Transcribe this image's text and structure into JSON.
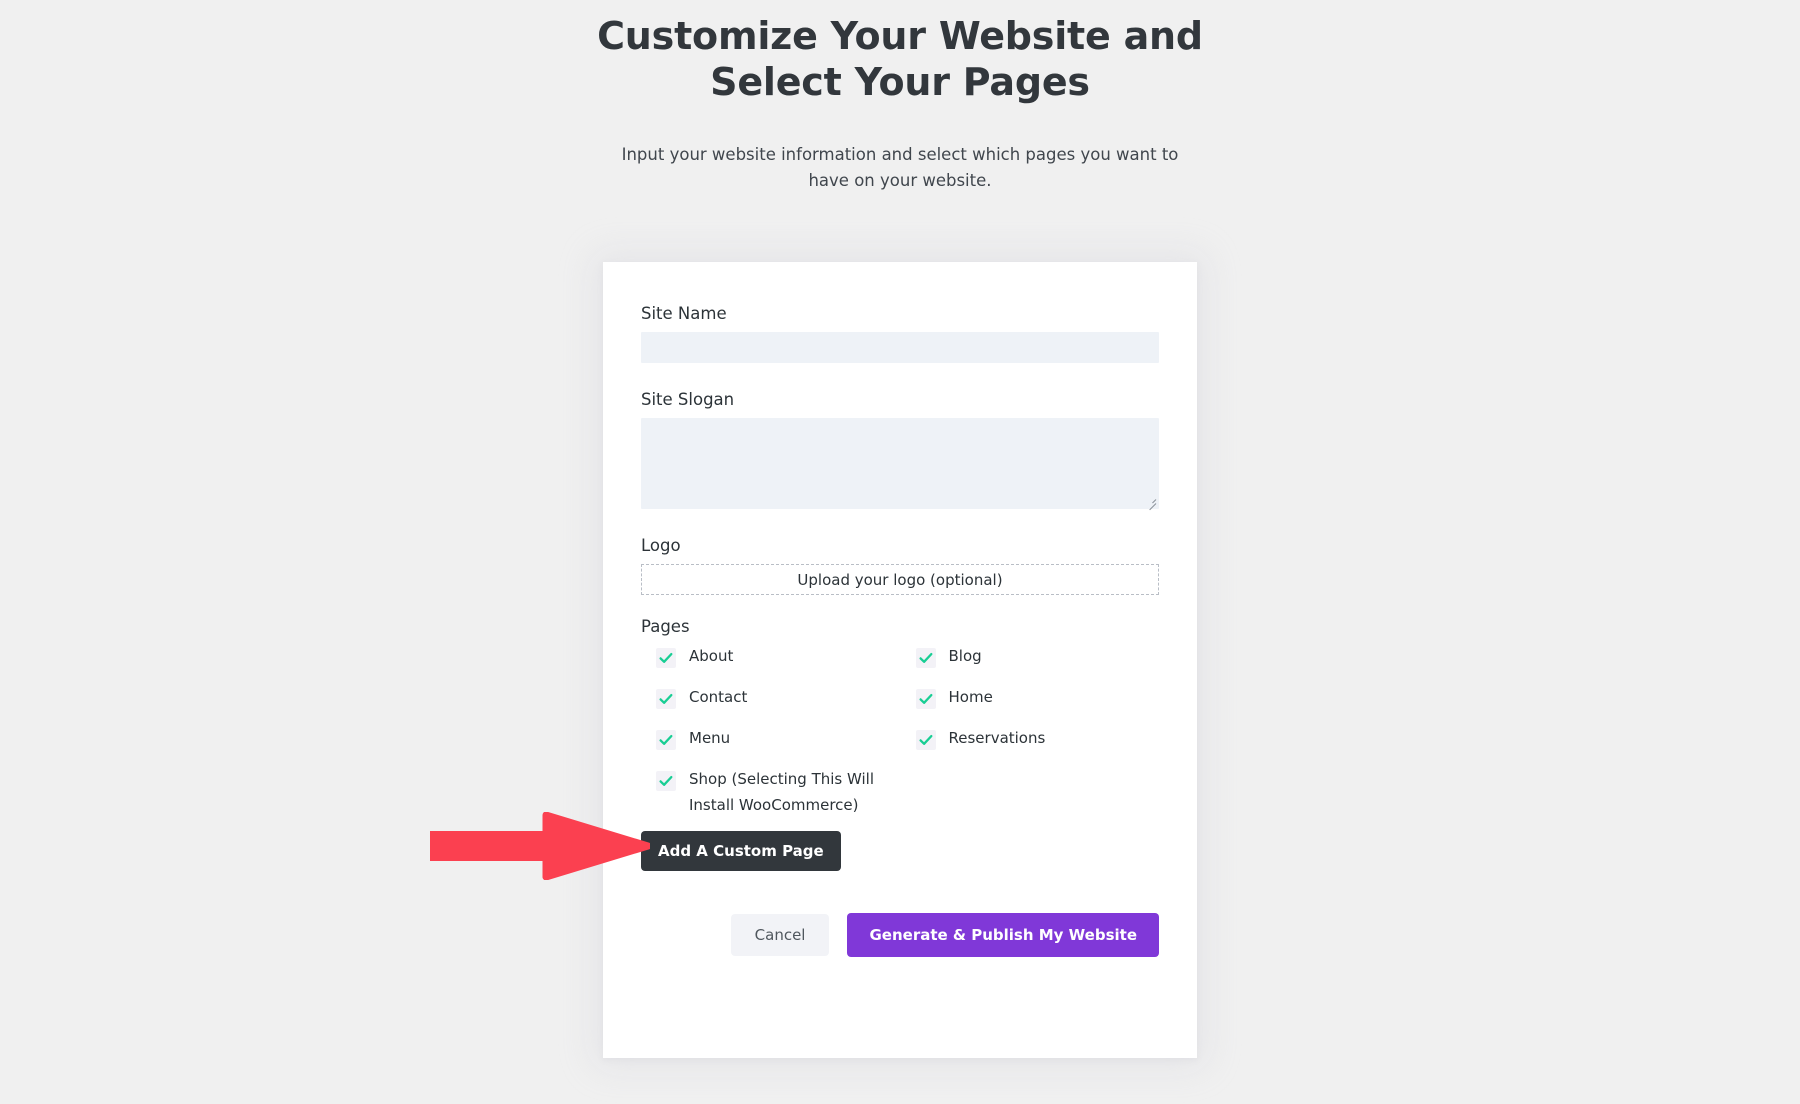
{
  "header": {
    "title": "Customize Your Website and Select Your Pages",
    "subtitle": "Input your website information and select which pages you want to have on your website."
  },
  "form": {
    "site_name": {
      "label": "Site Name",
      "value": "",
      "placeholder": ""
    },
    "site_slogan": {
      "label": "Site Slogan",
      "value": "",
      "placeholder": ""
    },
    "logo": {
      "label": "Logo",
      "upload_text": "Upload your logo (optional)"
    },
    "pages": {
      "label": "Pages",
      "options": [
        {
          "label": "About",
          "checked": true
        },
        {
          "label": "Blog",
          "checked": true
        },
        {
          "label": "Contact",
          "checked": true
        },
        {
          "label": "Home",
          "checked": true
        },
        {
          "label": "Menu",
          "checked": true
        },
        {
          "label": "Reservations",
          "checked": true
        },
        {
          "label": "Shop (Selecting This Will Install WooCommerce)",
          "checked": true
        }
      ]
    },
    "add_custom_page_label": "Add A Custom Page"
  },
  "actions": {
    "cancel_label": "Cancel",
    "primary_label": "Generate & Publish My Website"
  },
  "annotation": {
    "type": "right-arrow",
    "target": "shop-page-checkbox",
    "color": "#fb4050"
  },
  "colors": {
    "page_background": "#f0f0f0",
    "card_background": "#ffffff",
    "input_background": "#eef2f7",
    "text_primary": "#2c3338",
    "heading": "#32373c",
    "checkbox_background": "#f3f2f7",
    "check_mark": "#19ce94",
    "primary_button": "#8038d8",
    "dark_button": "#32373c",
    "cancel_button": "#f2f3f7",
    "annotation_arrow": "#fb4050"
  }
}
